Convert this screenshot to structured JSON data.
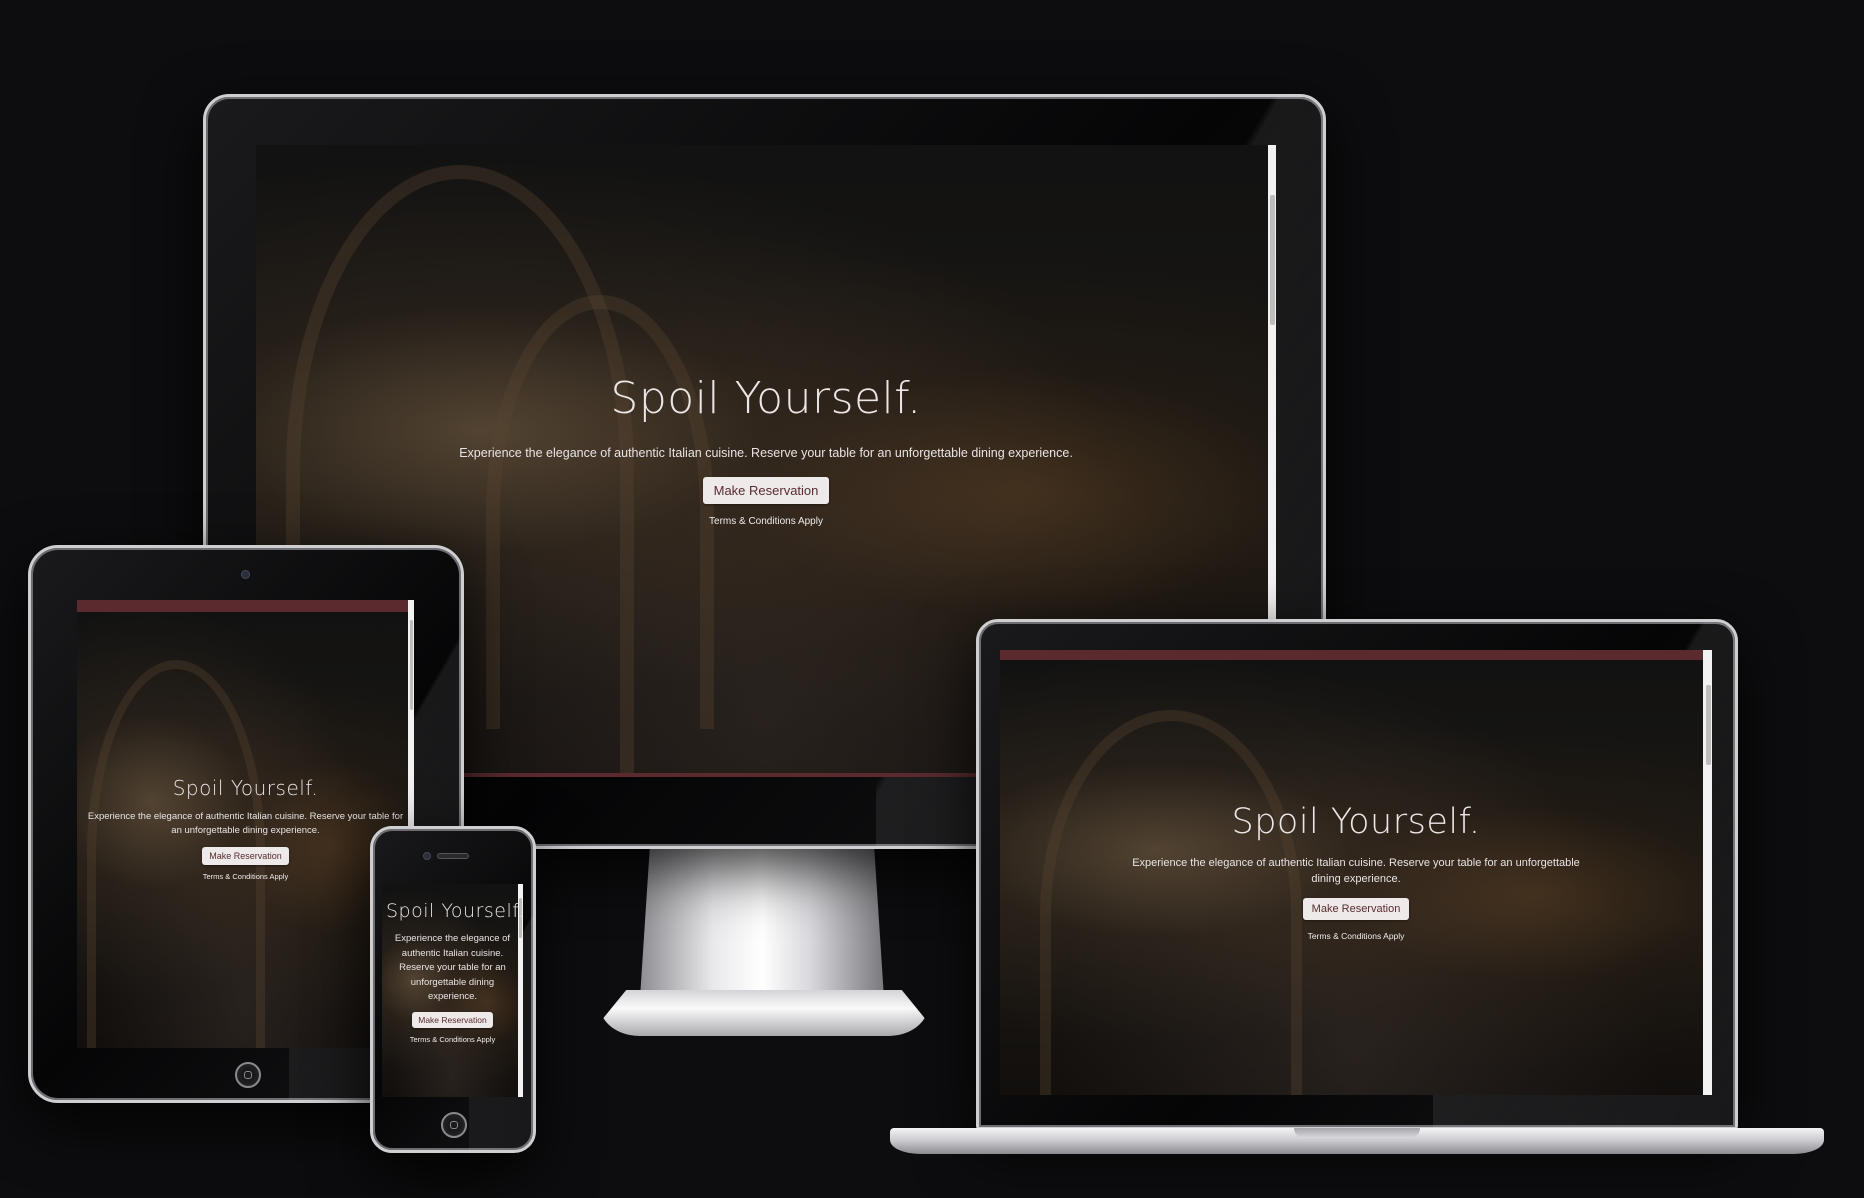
{
  "hero": {
    "title": "Spoil Yourself.",
    "tagline": "Experience the elegance of authentic Italian cuisine. Reserve your table for an unforgettable dining experience.",
    "cta_label": "Make Reservation",
    "terms": "Terms & Conditions Apply"
  },
  "colors": {
    "page_background": "#0d0c0e",
    "brand_burgundy": "#5a2a2e",
    "button_background": "#eeeaea",
    "button_text": "#5a2a2e",
    "hero_text": "#f1ecec"
  },
  "devices": [
    "desktop-monitor",
    "tablet",
    "laptop",
    "phone"
  ]
}
